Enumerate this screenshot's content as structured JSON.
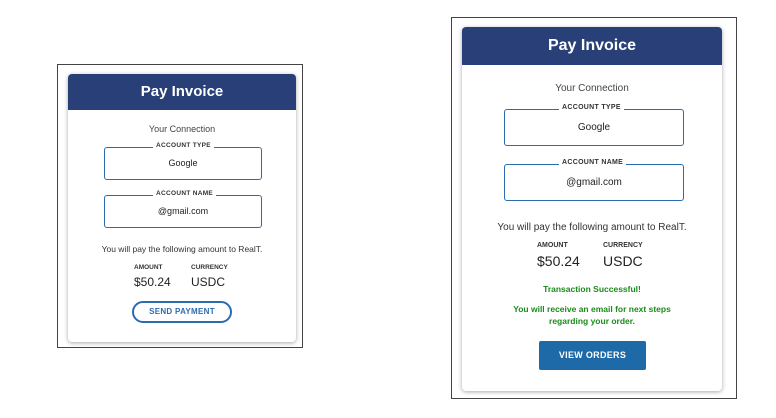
{
  "left_panel": {
    "title": "Pay Invoice",
    "connection_label": "Your Connection",
    "account_type_label": "ACCOUNT TYPE",
    "account_type_value": "Google",
    "account_name_label": "ACCOUNT NAME",
    "account_name_value": "@gmail.com",
    "pay_text": "You will pay the following amount to RealT.",
    "amount_label": "AMOUNT",
    "amount_value": "$50.24",
    "currency_label": "CURRENCY",
    "currency_value": "USDC",
    "send_button": "SEND PAYMENT"
  },
  "right_panel": {
    "title": "Pay Invoice",
    "connection_label": "Your Connection",
    "account_type_label": "ACCOUNT TYPE",
    "account_type_value": "Google",
    "account_name_label": "ACCOUNT NAME",
    "account_name_value": "@gmail.com",
    "pay_text": "You will pay the following amount to RealT.",
    "amount_label": "AMOUNT",
    "amount_value": "$50.24",
    "currency_label": "CURRENCY",
    "currency_value": "USDC",
    "success_title": "Transaction Successful!",
    "success_line1": "You will receive an email for next steps",
    "success_line2": "regarding your order.",
    "view_orders_button": "VIEW ORDERS"
  },
  "colors": {
    "header": "#284077",
    "accent": "#2b6cb0",
    "success": "#1a8a1a",
    "button": "#1e69a8"
  }
}
